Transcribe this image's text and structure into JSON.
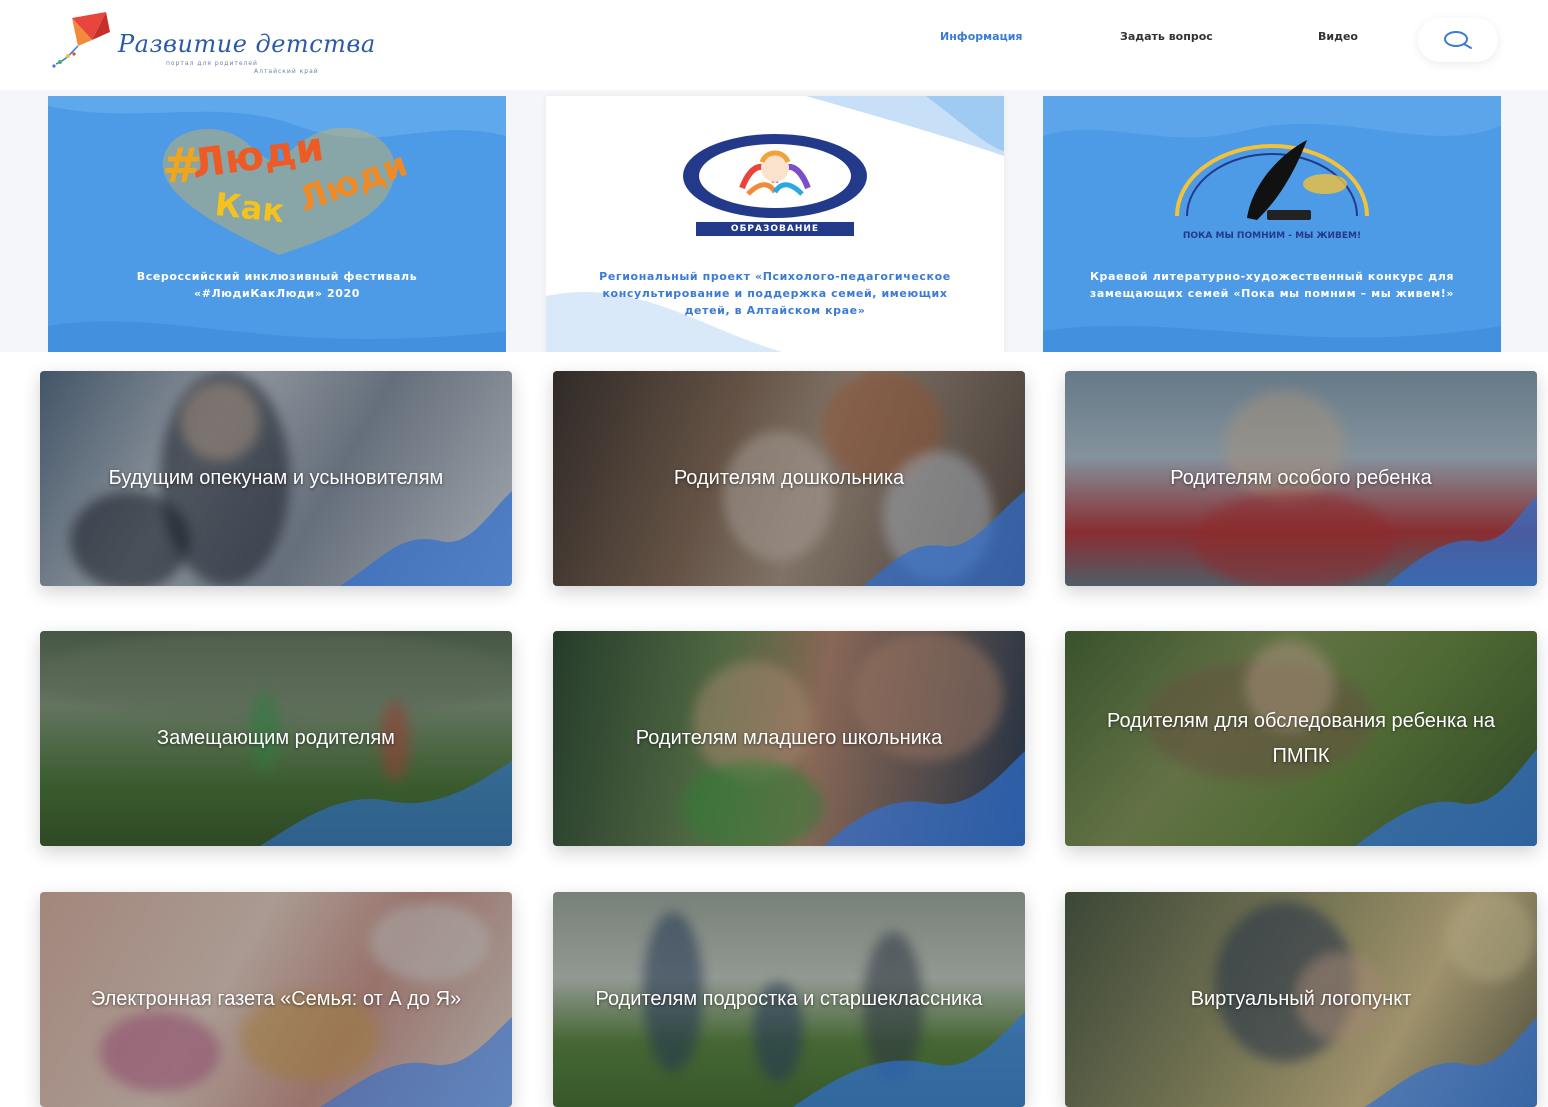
{
  "header": {
    "logo_title": "Развитие детства",
    "logo_sub": "портал для родителей",
    "logo_sub2": "Алтайский край",
    "nav": [
      {
        "label": "Информация",
        "active": true
      },
      {
        "label": "Задать вопрос",
        "active": false
      },
      {
        "label": "Видео",
        "active": false
      }
    ],
    "search_icon": "search-icon"
  },
  "banners": [
    {
      "art_text": "#ЛюдиКакЛюди",
      "text": "Всероссийский инклюзивный фестиваль «#ЛюдиКакЛюди» 2020"
    },
    {
      "art_label": "ОБРАЗОВАНИЕ",
      "text": "Региональный проект «Психолого-педагогическое консультирование и поддержка семей, имеющих детей, в Алтайском крае»"
    },
    {
      "art_text": "ПОКА МЫ ПОМНИМ - МЫ ЖИВЕМ!",
      "text": "Краевой литературно-художественный конкурс для замещающих семей «Пока мы помним – мы живем!»"
    }
  ],
  "cards": [
    {
      "title": "Будущим опекунам и усыновителям"
    },
    {
      "title": "Родителям дошкольника"
    },
    {
      "title": "Родителям особого ребенка"
    },
    {
      "title": "Замещающим родителям"
    },
    {
      "title": "Родителям младшего школьника"
    },
    {
      "title": "Родителям для обследования ребенка на ПМПК"
    },
    {
      "title": "Электронная газета «Семья: от А до Я»"
    },
    {
      "title": "Родителям подростка и старшеклассника"
    },
    {
      "title": "Виртуальный логопункт"
    }
  ],
  "colors": {
    "accent": "#3a7bd5",
    "banner_blue": "#4d9be6",
    "wave_blue": "#2f6fd0"
  }
}
